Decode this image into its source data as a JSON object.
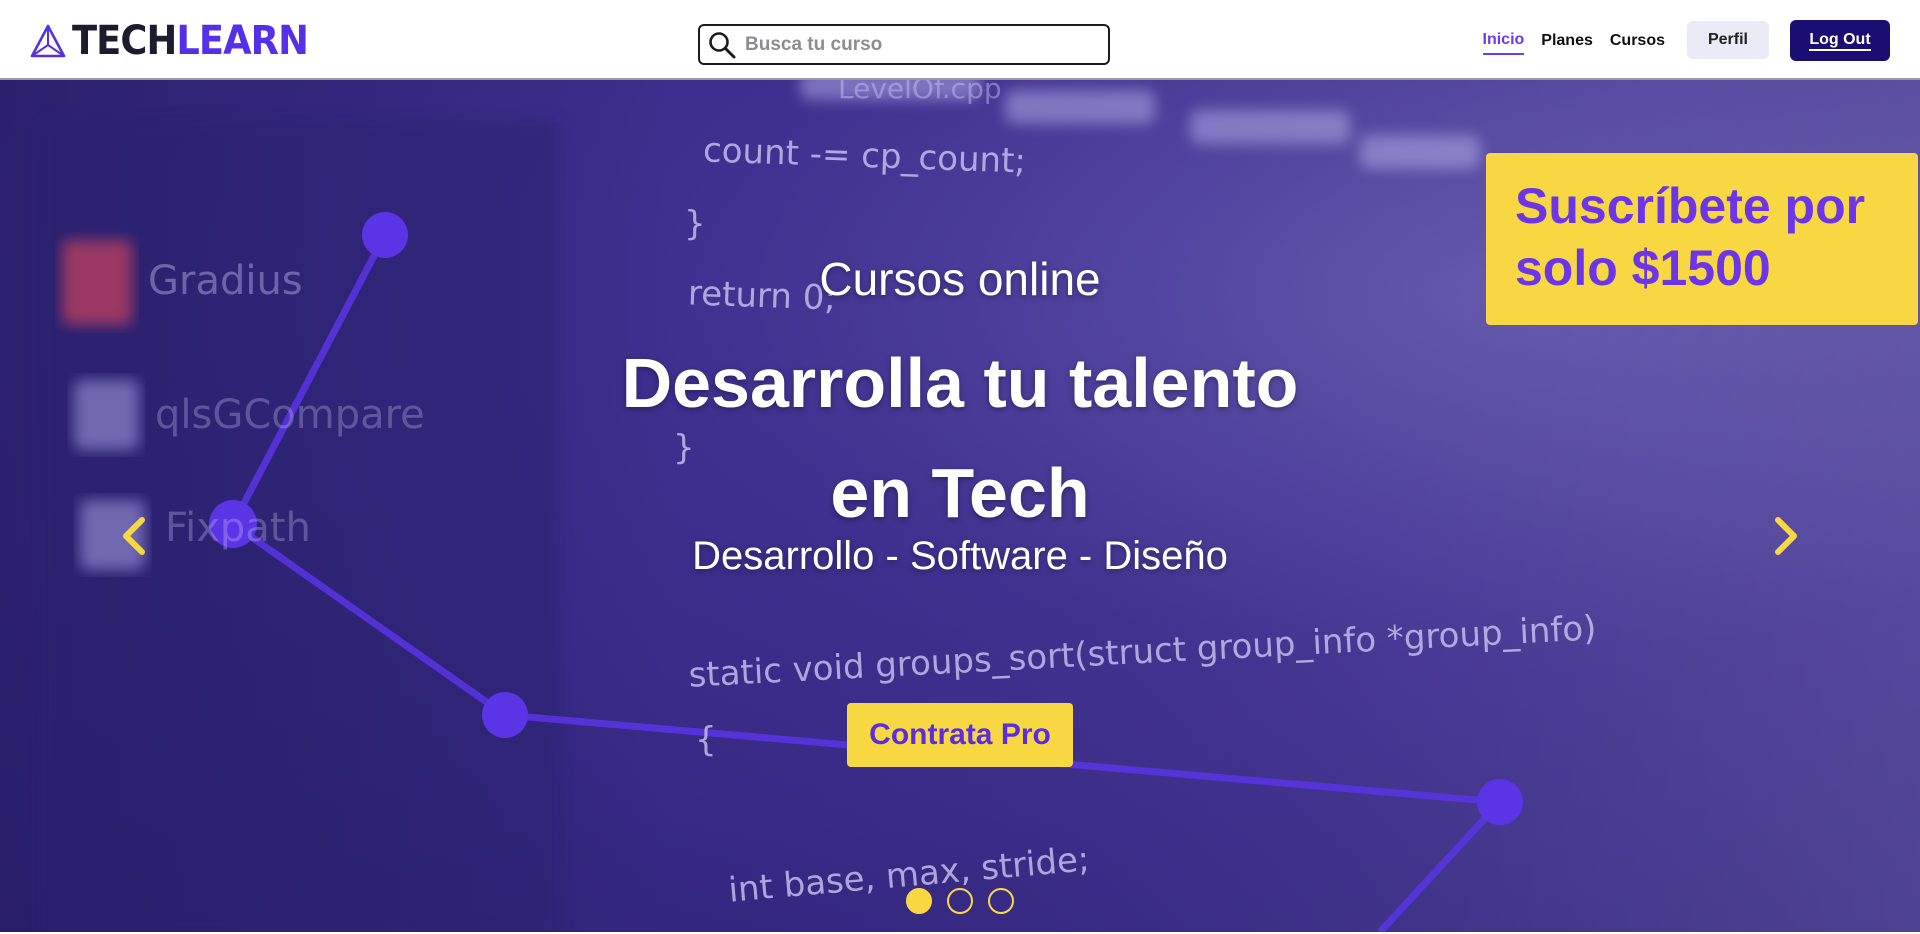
{
  "header": {
    "logo": {
      "part1": "TECH",
      "part2": "LEARN"
    },
    "search": {
      "placeholder": "Busca tu curso",
      "value": ""
    },
    "nav": {
      "inicio": "Inicio",
      "planes": "Planes",
      "cursos": "Cursos",
      "perfil": "Perfil",
      "logout": "Log Out"
    }
  },
  "hero": {
    "background_code": [
      "count -= cp_count;",
      "}",
      "return 0;",
      "}",
      "static void groups_sort(struct group_info *group_info)",
      "{",
      "int base, max, stride;",
      "Gradius",
      "qlsGCompare",
      "Fixpath",
      "LevelOf.cpp"
    ],
    "promo": {
      "line1": "Suscríbete por",
      "line2": "solo $1500"
    },
    "kicker": "Cursos online",
    "title_line1": "Desarrolla tu talento",
    "title_line2": "en Tech",
    "tags": "Desarrollo - Software - Diseño",
    "cta": "Contrata Pro",
    "carousel": {
      "slide_count": 3,
      "active_slide": 1
    }
  },
  "colors": {
    "accent_purple": "#5530e8",
    "yellow": "#f7d843",
    "navy_button": "#1a0e73",
    "hero_bg": "#3f2f8f"
  },
  "icons": [
    "logo-triangle-icon",
    "search-icon",
    "chevron-left-icon",
    "chevron-right-icon"
  ]
}
